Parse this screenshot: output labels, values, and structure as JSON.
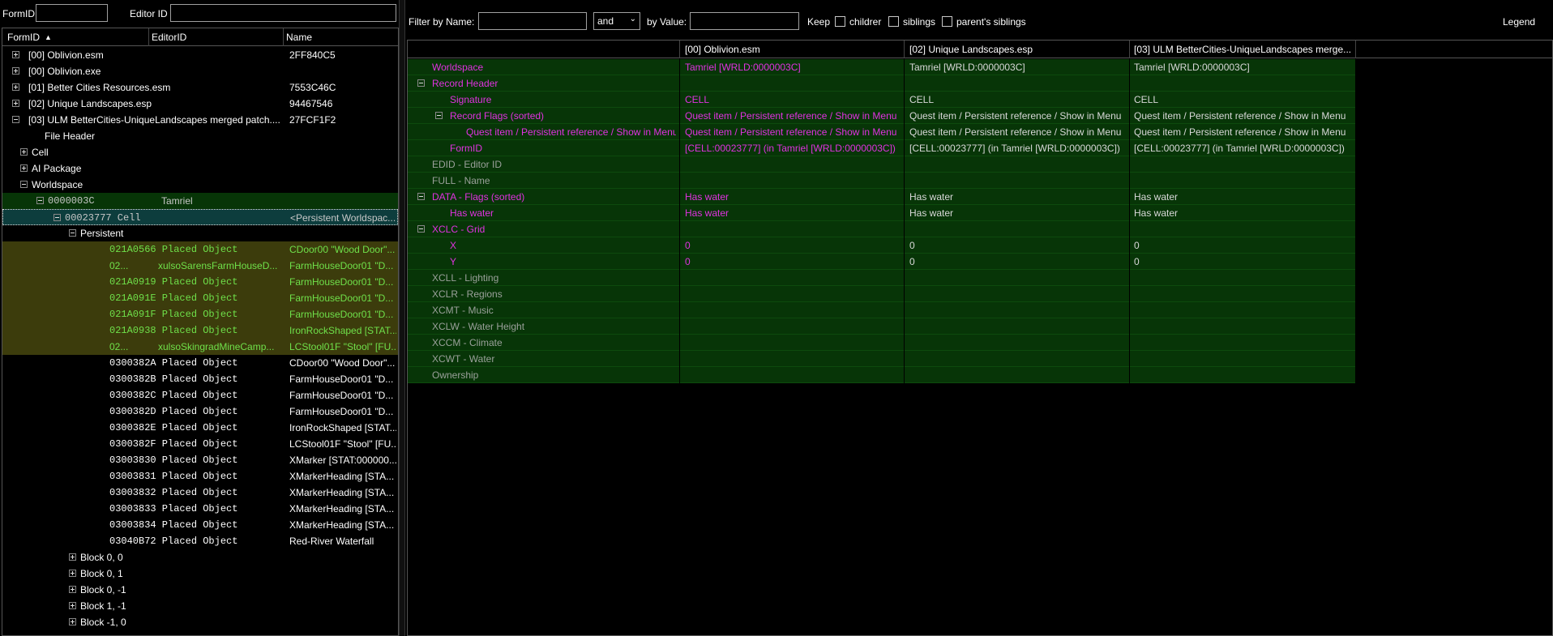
{
  "left_filter": {
    "formid_label": "FormID",
    "formid_value": "",
    "editorid_label": "Editor ID",
    "editorid_value": ""
  },
  "tree": {
    "columns": [
      "FormID",
      "EditorID",
      "Name"
    ],
    "sort_indicator": "▲",
    "rows": [
      {
        "text": "[00] Oblivion.esm",
        "name": "2FF840C5",
        "style": "plain"
      },
      {
        "text": "[00] Oblivion.exe",
        "name": "",
        "style": "plain"
      },
      {
        "text": "[01] Better Cities Resources.esm",
        "name": "7553C46C",
        "style": "plain"
      },
      {
        "text": "[02] Unique Landscapes.esp",
        "name": "94467546",
        "style": "plain"
      },
      {
        "text": "[03] ULM BetterCities-UniqueLandscapes merged patch....",
        "name": "27FCF1F2",
        "style": "plain"
      },
      {
        "text": "File Header",
        "name": "",
        "style": "plain"
      },
      {
        "text": "Cell",
        "name": "",
        "style": "plain"
      },
      {
        "text": "AI Package",
        "name": "",
        "style": "plain"
      },
      {
        "text": "Worldspace",
        "name": "",
        "style": "plain"
      },
      {
        "text": "0000003C",
        "editor": "Tamriel",
        "name": "",
        "style": "dark"
      },
      {
        "text": "00023777  Cell",
        "name": "<Persistent Worldspac...",
        "style": "sel"
      },
      {
        "text": "Persistent",
        "name": "",
        "style": "plain"
      },
      {
        "text": "021A0566  Placed Object",
        "name": "CDoor00 \"Wood Door\"...",
        "style": "olive"
      },
      {
        "text": "02...",
        "editor": "xulsoSarensFarmHouseD...",
        "name": "FarmHouseDoor01 \"D...",
        "style": "olive"
      },
      {
        "text": "021A0919  Placed Object",
        "name": "FarmHouseDoor01 \"D...",
        "style": "olive"
      },
      {
        "text": "021A091E  Placed Object",
        "name": "FarmHouseDoor01 \"D...",
        "style": "olive"
      },
      {
        "text": "021A091F  Placed Object",
        "name": "FarmHouseDoor01 \"D...",
        "style": "olive"
      },
      {
        "text": "021A0938  Placed Object",
        "name": "IronRockShaped [STAT...",
        "style": "olive"
      },
      {
        "text": "02...",
        "editor": "xulsoSkingradMineCamp...",
        "name": "LCStool01F \"Stool\" [FU...",
        "style": "olive"
      },
      {
        "text": "0300382A  Placed Object",
        "name": "CDoor00 \"Wood Door\"...",
        "style": "plain"
      },
      {
        "text": "0300382B  Placed Object",
        "name": "FarmHouseDoor01 \"D...",
        "style": "plain"
      },
      {
        "text": "0300382C  Placed Object",
        "name": "FarmHouseDoor01 \"D...",
        "style": "plain"
      },
      {
        "text": "0300382D  Placed Object",
        "name": "FarmHouseDoor01 \"D...",
        "style": "plain"
      },
      {
        "text": "0300382E  Placed Object",
        "name": "IronRockShaped [STAT...",
        "style": "plain"
      },
      {
        "text": "0300382F  Placed Object",
        "name": "LCStool01F \"Stool\" [FU...",
        "style": "plain"
      },
      {
        "text": "03003830  Placed Object",
        "name": "XMarker [STAT:000000...",
        "style": "plain"
      },
      {
        "text": "03003831  Placed Object",
        "name": "XMarkerHeading [STA...",
        "style": "plain"
      },
      {
        "text": "03003832  Placed Object",
        "name": "XMarkerHeading [STA...",
        "style": "plain"
      },
      {
        "text": "03003833  Placed Object",
        "name": "XMarkerHeading [STA...",
        "style": "plain"
      },
      {
        "text": "03003834  Placed Object",
        "name": "XMarkerHeading [STA...",
        "style": "plain"
      },
      {
        "text": "03040B72  Placed Object",
        "name": "Red-River Waterfall",
        "style": "plain"
      },
      {
        "text": "Block 0, 0",
        "name": "",
        "style": "plain"
      },
      {
        "text": "Block 0, 1",
        "name": "",
        "style": "plain"
      },
      {
        "text": "Block 0, -1",
        "name": "",
        "style": "plain"
      },
      {
        "text": "Block 1, -1",
        "name": "",
        "style": "plain"
      },
      {
        "text": "Block -1, 0",
        "name": "",
        "style": "plain"
      }
    ]
  },
  "right_filter": {
    "by_name_label": "Filter by Name:",
    "by_name_value": "",
    "operator": "and",
    "by_value_label": "by Value:",
    "by_value_value": "",
    "keep_label": "Keep",
    "children_label": "childrer",
    "siblings_label": "siblings",
    "parents_siblings_label": "parent's siblings",
    "legend_label": "Legend"
  },
  "grid": {
    "columns": [
      "[00] Oblivion.esm",
      "[02] Unique Landscapes.esp",
      "[03] ULM BetterCities-UniqueLandscapes merge..."
    ],
    "rows": [
      {
        "label": "Worldspace",
        "v1": "Tamriel [WRLD:0000003C]",
        "v2": "Tamriel [WRLD:0000003C]",
        "v3": "Tamriel [WRLD:0000003C]",
        "style": "magenta"
      },
      {
        "label": "Record Header",
        "v1": "",
        "v2": "",
        "v3": "",
        "style": "magenta"
      },
      {
        "label": "Signature",
        "v1": "CELL",
        "v2": "CELL",
        "v3": "CELL",
        "style": "magenta"
      },
      {
        "label": "Record Flags (sorted)",
        "v1": "Quest item / Persistent reference / Show in Menu",
        "v2": "Quest item / Persistent reference / Show in Menu",
        "v3": "Quest item / Persistent reference / Show in Menu",
        "style": "magenta"
      },
      {
        "label": "Quest item / Persistent reference / Show in Menu",
        "v1": "Quest item / Persistent reference / Show in Menu",
        "v2": "Quest item / Persistent reference / Show in Menu",
        "v3": "Quest item / Persistent reference / Show in Menu",
        "style": "magenta"
      },
      {
        "label": "FormID",
        "v1": "[CELL:00023777] (in Tamriel [WRLD:0000003C])",
        "v2": "[CELL:00023777] (in Tamriel [WRLD:0000003C])",
        "v3": "[CELL:00023777] (in Tamriel [WRLD:0000003C])",
        "style": "magenta"
      },
      {
        "label": "EDID - Editor ID",
        "v1": "",
        "v2": "",
        "v3": "",
        "style": "dim"
      },
      {
        "label": "FULL - Name",
        "v1": "",
        "v2": "",
        "v3": "",
        "style": "dim"
      },
      {
        "label": "DATA - Flags (sorted)",
        "v1": "Has water",
        "v2": "Has water",
        "v3": "Has water",
        "style": "magenta"
      },
      {
        "label": "Has water",
        "v1": "Has water",
        "v2": "Has water",
        "v3": "Has water",
        "style": "magenta"
      },
      {
        "label": "XCLC - Grid",
        "v1": "",
        "v2": "",
        "v3": "",
        "style": "magenta"
      },
      {
        "label": "X",
        "v1": "0",
        "v2": "0",
        "v3": "0",
        "style": "magenta"
      },
      {
        "label": "Y",
        "v1": "0",
        "v2": "0",
        "v3": "0",
        "style": "magenta"
      },
      {
        "label": "XCLL - Lighting",
        "v1": "",
        "v2": "",
        "v3": "",
        "style": "dim"
      },
      {
        "label": "XCLR - Regions",
        "v1": "",
        "v2": "",
        "v3": "",
        "style": "dim"
      },
      {
        "label": "XCMT - Music",
        "v1": "",
        "v2": "",
        "v3": "",
        "style": "dim"
      },
      {
        "label": "XCLW - Water Height",
        "v1": "",
        "v2": "",
        "v3": "",
        "style": "dim"
      },
      {
        "label": "XCCM - Climate",
        "v1": "",
        "v2": "",
        "v3": "",
        "style": "dim"
      },
      {
        "label": "XCWT - Water",
        "v1": "",
        "v2": "",
        "v3": "",
        "style": "dim"
      },
      {
        "label": "Ownership",
        "v1": "",
        "v2": "",
        "v3": "",
        "style": "dim"
      }
    ]
  }
}
